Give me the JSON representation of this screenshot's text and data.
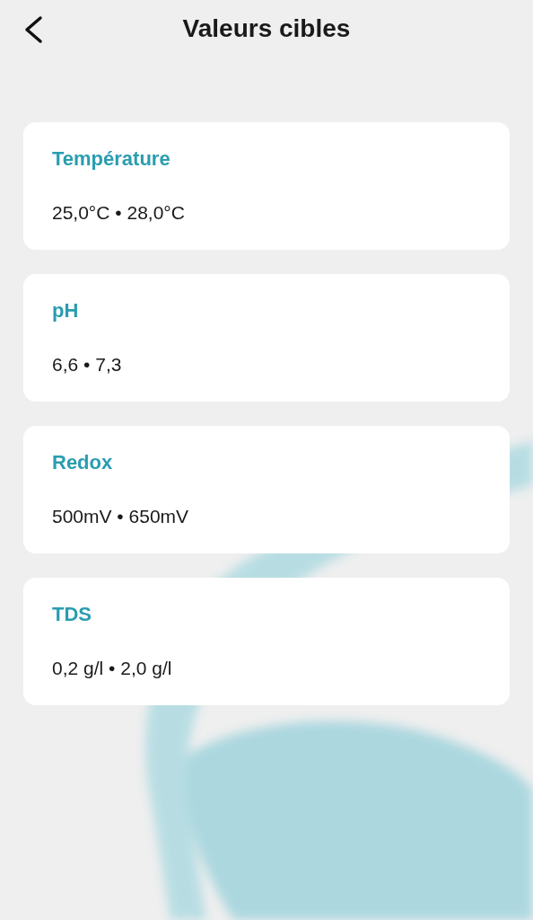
{
  "header": {
    "title": "Valeurs cibles"
  },
  "cards": [
    {
      "label": "Température",
      "value": "25,0°C • 28,0°C"
    },
    {
      "label": "pH",
      "value": "6,6 • 7,3"
    },
    {
      "label": "Redox",
      "value": "500mV • 650mV"
    },
    {
      "label": "TDS",
      "value": "0,2 g/l • 2,0 g/l"
    }
  ]
}
